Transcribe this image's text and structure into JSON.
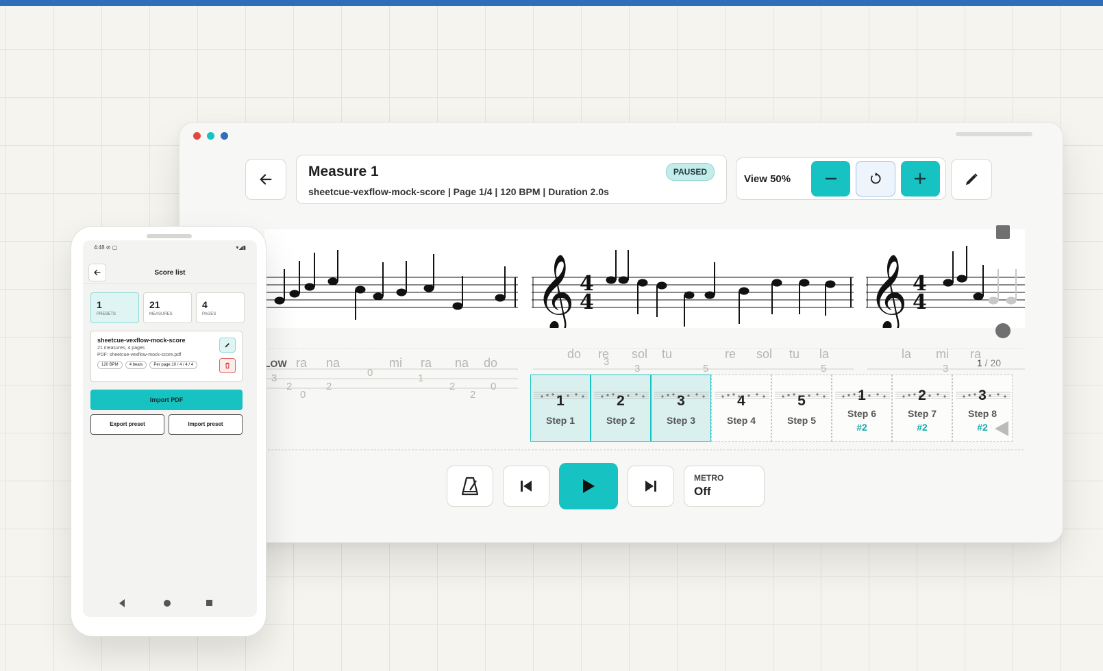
{
  "tablet": {
    "window_dots": [
      "#e0473f",
      "#17c2c2",
      "#2f6fba"
    ],
    "header": {
      "title": "Measure 1",
      "subtitle": "sheetcue-vexflow-mock-score | Page 1/4 | 120 BPM | Duration 2.0s",
      "status_badge": "PAUSED"
    },
    "view": {
      "label": "View 50%"
    },
    "score": {
      "lyrics_left": [
        "LOW",
        "ra",
        "na",
        "mi",
        "ra",
        "na",
        "do"
      ],
      "lyrics_mid": [
        "do",
        "re",
        "sol",
        "tu",
        "re",
        "sol",
        "tu",
        "la"
      ],
      "lyrics_right": [
        "la",
        "mi",
        "ra"
      ],
      "page_indicator": {
        "current": "1",
        "total": " / 20"
      }
    },
    "steps": [
      {
        "num": "1",
        "label": "Step 1",
        "sub": "",
        "selected": true
      },
      {
        "num": "2",
        "label": "Step 2",
        "sub": "",
        "selected": true
      },
      {
        "num": "3",
        "label": "Step 3",
        "sub": "",
        "selected": true
      },
      {
        "num": "4",
        "label": "Step 4",
        "sub": "",
        "selected": false
      },
      {
        "num": "5",
        "label": "Step 5",
        "sub": "",
        "selected": false
      },
      {
        "num": "1",
        "label": "Step 6",
        "sub": "#2",
        "selected": false
      },
      {
        "num": "2",
        "label": "Step 7",
        "sub": "#2",
        "selected": false
      },
      {
        "num": "3",
        "label": "Step 8",
        "sub": "#2",
        "selected": false
      }
    ],
    "metronome": {
      "label": "METRO",
      "value": "Off"
    }
  },
  "phone": {
    "status_time": "4:48",
    "title": "Score list",
    "stats": [
      {
        "value": "1",
        "label": "PRESETS"
      },
      {
        "value": "21",
        "label": "MEASURES"
      },
      {
        "value": "4",
        "label": "PAGES"
      }
    ],
    "preset": {
      "name": "sheetcue-vexflow-mock-score",
      "meta": "21 measures, 4 pages",
      "pdf": "PDF: sheetcue-vexflow-mock-score.pdf",
      "chips": [
        "120 BPM",
        "4 beats",
        "Per page 10 / 4 / 4 / 4"
      ]
    },
    "import_pdf": "Import PDF",
    "export_preset": "Export preset",
    "import_preset": "Import preset"
  }
}
